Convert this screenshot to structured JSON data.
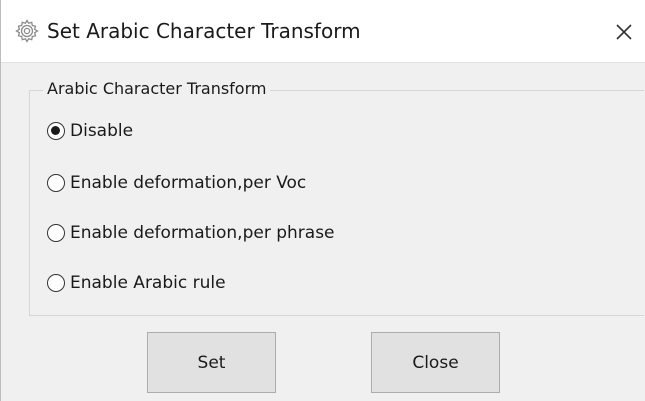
{
  "window": {
    "title": "Set Arabic Character Transform",
    "title_icon": "gear-icon",
    "close_icon": "close-icon"
  },
  "group": {
    "title": "Arabic Character Transform",
    "options": [
      {
        "label": "Disable",
        "checked": true
      },
      {
        "label": "Enable deformation,per Voc",
        "checked": false
      },
      {
        "label": "Enable deformation,per phrase",
        "checked": false
      },
      {
        "label": "Enable Arabic rule",
        "checked": false
      }
    ]
  },
  "buttons": {
    "set_label": "Set",
    "close_label": "Close"
  },
  "colors": {
    "dialog_background": "#f0f0f0",
    "titlebar_background": "#ffffff",
    "button_background": "#e1e1e1",
    "button_border": "#adadad",
    "text": "#1a1a1a"
  }
}
